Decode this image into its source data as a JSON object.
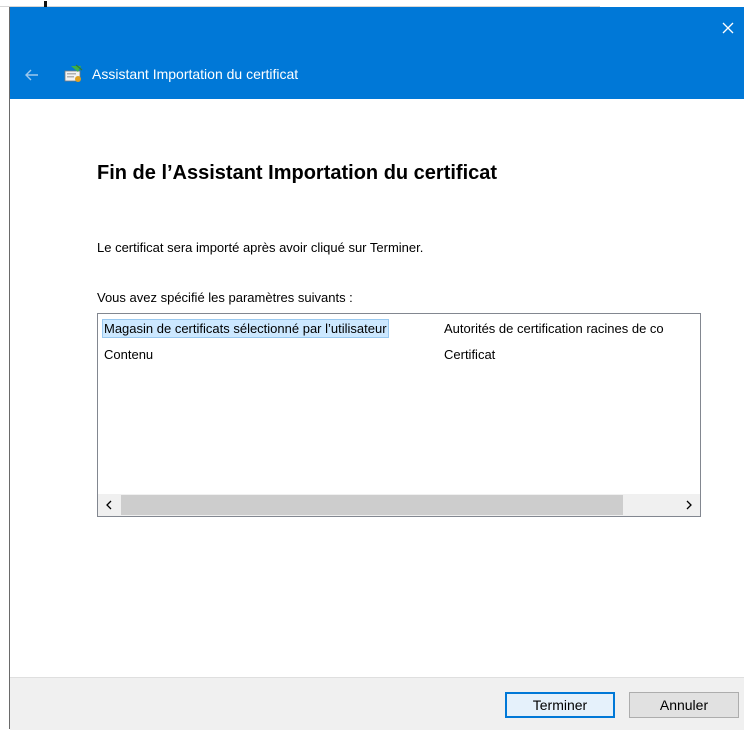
{
  "window": {
    "title": "Assistant Importation du certificat"
  },
  "page": {
    "heading": "Fin de l’Assistant Importation du certificat",
    "intro": "Le certificat sera importé après avoir cliqué sur Terminer.",
    "settings_label": "Vous avez spécifié les paramètres suivants :"
  },
  "settings": {
    "rows": [
      {
        "name": "Magasin de certificats sélectionné par l’utilisateur",
        "value": "Autorités de certification racines de co"
      },
      {
        "name": "Contenu",
        "value": "Certificat"
      }
    ]
  },
  "buttons": {
    "finish": "Terminer",
    "cancel": "Annuler"
  },
  "colors": {
    "titlebar": "#0078d7",
    "selection": "#cce8ff",
    "footer": "#f0f0f0"
  },
  "icons": {
    "close": "close-icon",
    "back": "back-arrow-icon",
    "wizard": "certificate-wizard-icon",
    "scroll_left": "chevron-left-icon",
    "scroll_right": "chevron-right-icon"
  }
}
